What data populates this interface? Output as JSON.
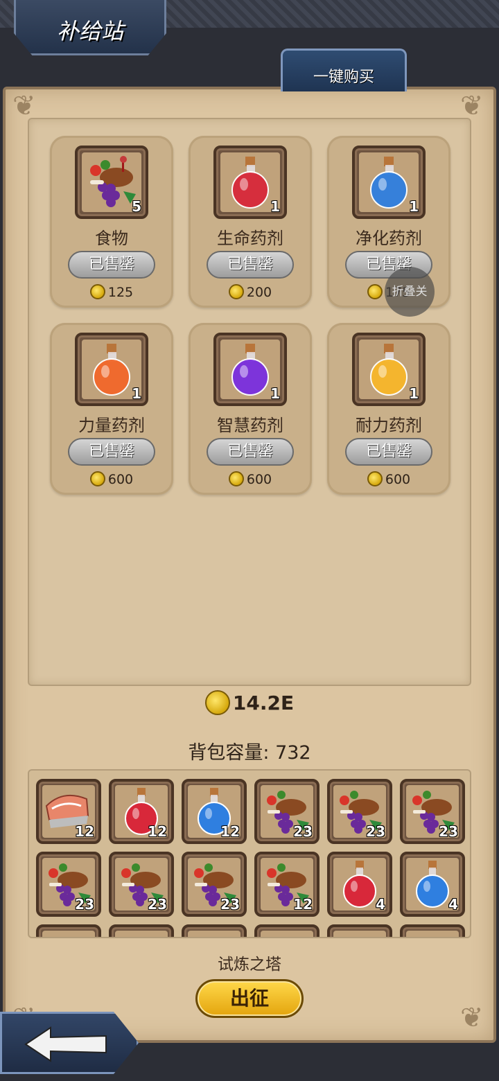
{
  "header": {
    "title": "补给站",
    "buy_all_label": "一键购买"
  },
  "shop_items": [
    {
      "name": "食物",
      "qty": "5",
      "status": "已售罄",
      "price": "125",
      "icon": "food-icon"
    },
    {
      "name": "生命药剂",
      "qty": "1",
      "status": "已售罄",
      "price": "200",
      "icon": "red-potion-icon",
      "color": "#d8283a"
    },
    {
      "name": "净化药剂",
      "qty": "1",
      "status": "已售罄",
      "price": "175",
      "icon": "blue-potion-icon",
      "color": "#2f7fe0"
    },
    {
      "name": "力量药剂",
      "qty": "1",
      "status": "已售罄",
      "price": "600",
      "icon": "orange-potion-icon",
      "color": "#f2682a"
    },
    {
      "name": "智慧药剂",
      "qty": "1",
      "status": "已售罄",
      "price": "600",
      "icon": "purple-potion-icon",
      "color": "#7a2fe0"
    },
    {
      "name": "耐力药剂",
      "qty": "1",
      "status": "已售罄",
      "price": "600",
      "icon": "yellow-potion-icon",
      "color": "#f7b72a"
    }
  ],
  "floating_button": {
    "label": "折叠关"
  },
  "gold": {
    "amount": "14.2E"
  },
  "bag": {
    "capacity_label": "背包容量: 732",
    "slots": [
      {
        "icon": "meat-icon",
        "qty": "12"
      },
      {
        "icon": "red-potion-icon",
        "qty": "12"
      },
      {
        "icon": "blue-potion-icon",
        "qty": "12"
      },
      {
        "icon": "food-icon",
        "qty": "23"
      },
      {
        "icon": "food-icon",
        "qty": "23"
      },
      {
        "icon": "food-icon",
        "qty": "23"
      },
      {
        "icon": "food-icon",
        "qty": "23"
      },
      {
        "icon": "food-icon",
        "qty": "23"
      },
      {
        "icon": "food-icon",
        "qty": "23"
      },
      {
        "icon": "food-icon",
        "qty": "12"
      },
      {
        "icon": "red-potion-icon",
        "qty": "4"
      },
      {
        "icon": "blue-potion-icon",
        "qty": "4"
      }
    ]
  },
  "footer": {
    "location": "试炼之塔",
    "go_label": "出征"
  },
  "colors": {
    "parchment": "#dcc5a1",
    "gold": "#ffd84a",
    "navy": "#23324a"
  }
}
